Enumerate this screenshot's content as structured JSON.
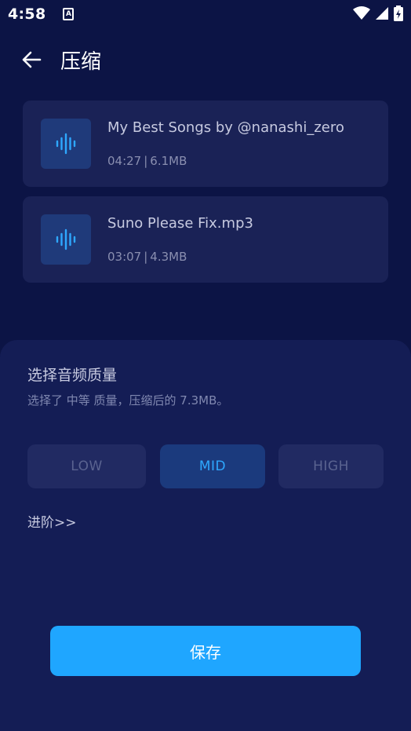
{
  "status_bar": {
    "time": "4:58",
    "icons": [
      "accessibility-a-icon",
      "wifi-icon",
      "signal-icon",
      "battery-icon"
    ]
  },
  "header": {
    "back_icon": "arrow-left-icon",
    "title": "压缩"
  },
  "files": [
    {
      "name": "My Best Songs by @nanashi_zero",
      "duration": "04:27",
      "separator": "|",
      "size": "6.1MB",
      "icon": "audio-wave-icon"
    },
    {
      "name": "Suno Please Fix.mp3",
      "duration": "03:07",
      "separator": "|",
      "size": "4.3MB",
      "icon": "audio-wave-icon"
    }
  ],
  "quality_sheet": {
    "title": "选择音频质量",
    "description": "选择了 中等 质量，压缩后的 7.3MB。",
    "options": [
      {
        "label": "LOW",
        "selected": false
      },
      {
        "label": "MID",
        "selected": true
      },
      {
        "label": "HIGH",
        "selected": false
      }
    ],
    "advanced_label": "进阶>>",
    "save_label": "保存"
  },
  "colors": {
    "background": "#0c1445",
    "card": "#1a2256",
    "sheet": "#141d55",
    "accent": "#1fa6ff",
    "selected_text": "#2ea8ff"
  }
}
